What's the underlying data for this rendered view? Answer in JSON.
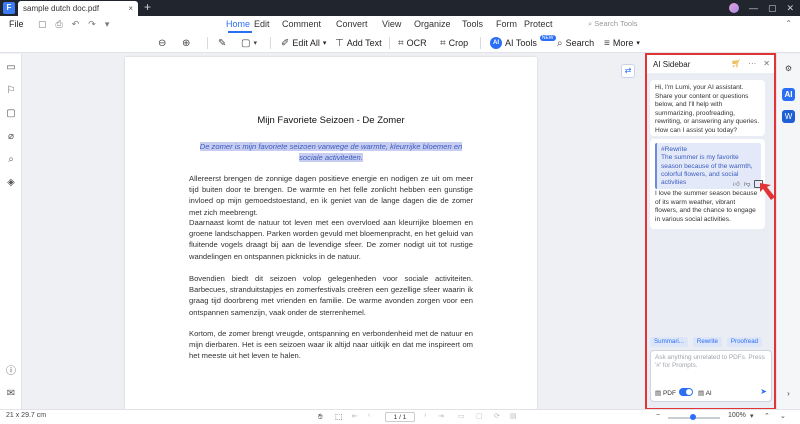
{
  "titlebar": {
    "logo": "F",
    "tab_title": "sample dutch doc.pdf",
    "tab_close": "×",
    "new_tab": "+",
    "controls": [
      "—",
      "▢",
      "✕"
    ]
  },
  "menubar": {
    "file": "File",
    "tabs": [
      "Home",
      "Edit",
      "Comment",
      "Convert",
      "View",
      "Organize",
      "Tools",
      "Form",
      "Protect"
    ],
    "search_tools": "Search Tools",
    "active_tab": "Home"
  },
  "toolbar": {
    "edit_all": "Edit All",
    "add_text": "Add Text",
    "ocr": "OCR",
    "crop": "Crop",
    "ai_tools": "AI Tools",
    "ai_badge": "AI",
    "new_badge": "NEW",
    "search": "Search",
    "more": "More"
  },
  "document": {
    "title": "Mijn Favoriete Seizoen - De Zomer",
    "subtitle": "De zomer is mijn favoriete seizoen vanwege de warmte, kleurrijke bloemen en sociale activiteiten.",
    "paragraphs": [
      "Allereerst brengen de zonnige dagen positieve energie en nodigen ze uit om meer tijd buiten door te brengen. De warmte en het felle zonlicht hebben een gunstige invloed op mijn gemoedstoestand, en ik geniet van de lange dagen die de zomer met zich meebrengt.",
      "Daarnaast komt de natuur tot leven met een overvloed aan kleurrijke bloemen en groene landschappen. Parken worden gevuld met bloemenpracht, en het geluid van fluitende vogels draagt bij aan de levendige sfeer. De zomer nodigt uit tot rustige wandelingen en ontspannen picknicks in de natuur.",
      "Bovendien biedt dit seizoen volop gelegenheden voor sociale activiteiten. Barbecues, stranduitstapjes en zomerfestivals creëren een gezellige sfeer waarin ik graag tijd doorbreng met vrienden en familie. De warme avonden zorgen voor een ontspannen samenzijn, vaak onder de sterrenhemel.",
      "Kortom, de zomer brengt vreugde, ontspanning en verbondenheid met de natuur en mijn dierbaren. Het is een seizoen waar ik altijd naar uitkijk en dat me inspireert om het meeste uit het leven te halen."
    ]
  },
  "ai_sidebar": {
    "title": "AI Sidebar",
    "greeting": "Hi, I'm Lumi, your AI assistant. Share your content or questions below, and I'll help with summarizing, proofreading, rewriting, or answering any queries. How can I assist you today?",
    "rewrite_label": "#Rewrite",
    "rewrite_text": "The summer is my favorite season because of the warmth, colorful flowers, and social activities",
    "response": "I love the summer season because of its warm weather, vibrant flowers, and the chance to engage in various social activities.",
    "chips": [
      "Summari...",
      "Rewrite",
      "Proofread"
    ],
    "input_placeholder": "Ask anything unrelated to PDFs. Press '#' for Prompts.",
    "pdf_label": "PDF",
    "ai_label": "AI",
    "toggle_on": true
  },
  "statusbar": {
    "page_size": "21 x 29.7 cm",
    "page_indicator": "1 / 1",
    "zoom": "100%"
  },
  "colors": {
    "accent": "#2b6ef6",
    "highlight_box": "#e23336",
    "titlebar": "#20252e"
  }
}
